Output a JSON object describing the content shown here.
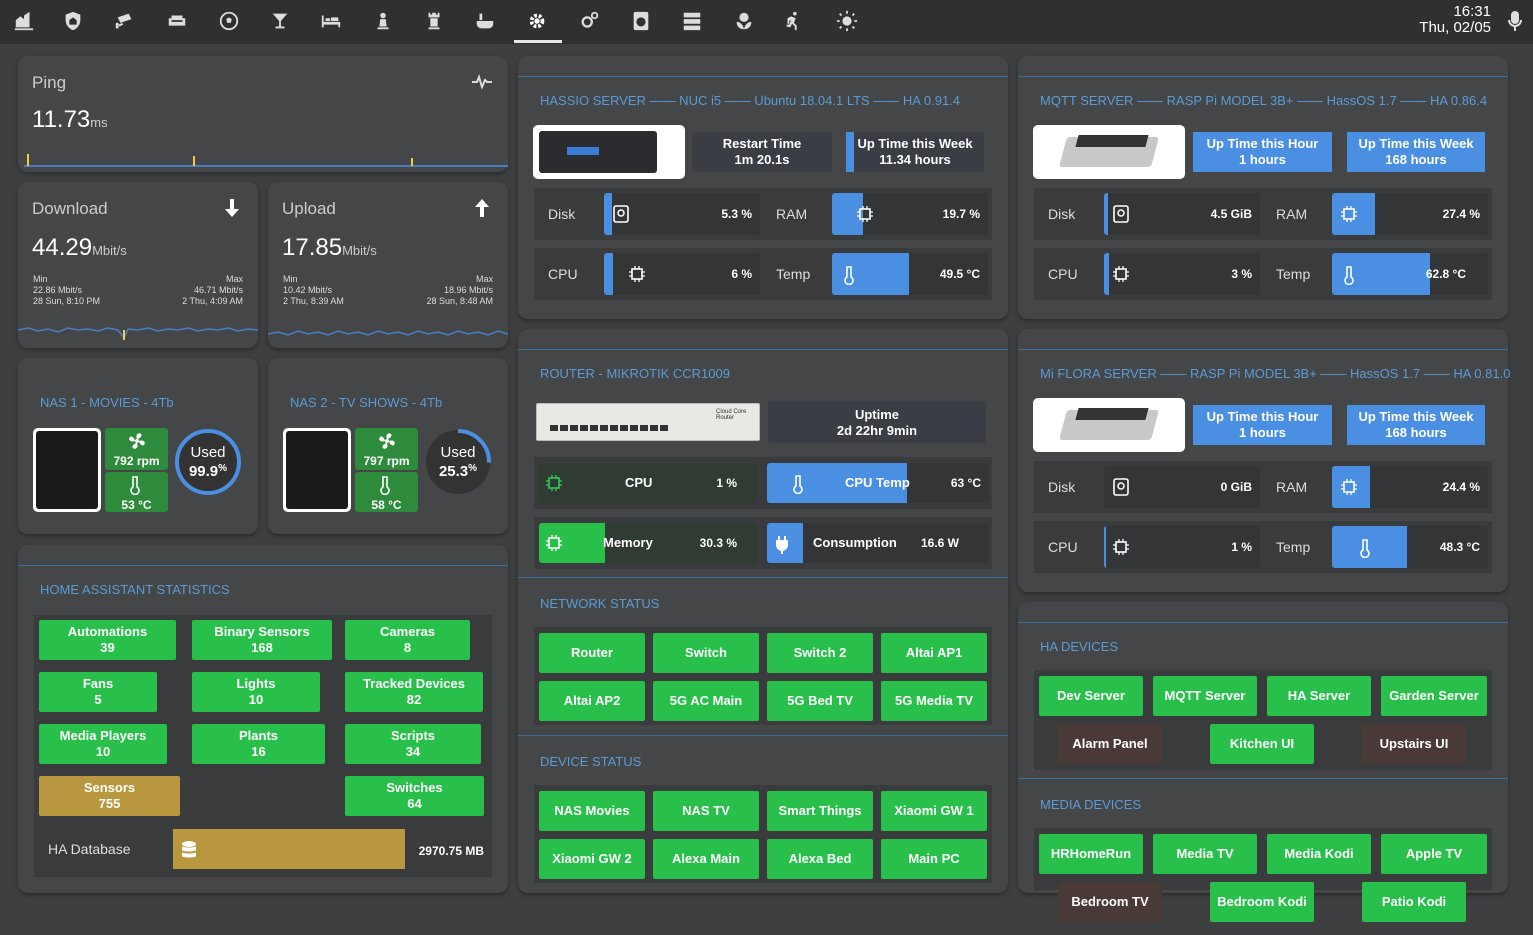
{
  "topbar": {
    "tabs": [
      "home-icon",
      "shield-icon",
      "cctv-icon",
      "sofa-icon",
      "soccer-icon",
      "cocktail-icon",
      "bed-icon",
      "chess-pawn-icon",
      "chess-rook-icon",
      "bathtub-icon",
      "cog-icon",
      "cogs-icon",
      "washing-machine-icon",
      "server-icon",
      "flower-icon",
      "run-icon",
      "sun-icon"
    ],
    "active_tab": "cog-icon",
    "time": "16:31",
    "date": "Thu, 02/05"
  },
  "ping": {
    "label": "Ping",
    "value": "11.73",
    "unit": "ms"
  },
  "download": {
    "label": "Download",
    "value": "44.29",
    "unit": "Mbit/s",
    "min_label": "Min",
    "min_value": "22.86 Mbit/s",
    "min_time": "28 Sun, 8:10 PM",
    "max_label": "Max",
    "max_value": "46.71 Mbit/s",
    "max_time": "2 Thu, 4:09 AM"
  },
  "upload": {
    "label": "Upload",
    "value": "17.85",
    "unit": "Mbit/s",
    "min_label": "Min",
    "min_value": "10.42 Mbit/s",
    "min_time": "2 Thu, 8:39 AM",
    "max_label": "Max",
    "max_value": "18.96 Mbit/s",
    "max_time": "28 Sun, 8:48 AM"
  },
  "nas1": {
    "title": "NAS 1 - MOVIES - 4Tb",
    "fan": "792 rpm",
    "temp": "53 °C",
    "used_label": "Used",
    "used_value": "99.9",
    "used_pct": 99.9
  },
  "nas2": {
    "title": "NAS 2 - TV SHOWS - 4Tb",
    "fan": "797 rpm",
    "temp": "58 °C",
    "used_label": "Used",
    "used_value": "25.3",
    "used_pct": 25.3
  },
  "ha_stats": {
    "title": "HOME ASSISTANT STATISTICS",
    "items": [
      {
        "label": "Automations",
        "value": "39"
      },
      {
        "label": "Binary Sensors",
        "value": "168"
      },
      {
        "label": "Cameras",
        "value": "8"
      },
      {
        "label": "Fans",
        "value": "5"
      },
      {
        "label": "Lights",
        "value": "10"
      },
      {
        "label": "Tracked Devices",
        "value": "82"
      },
      {
        "label": "Media Players",
        "value": "10"
      },
      {
        "label": "Plants",
        "value": "16"
      },
      {
        "label": "Scripts",
        "value": "34"
      },
      {
        "label": "Sensors",
        "value": "755"
      },
      {
        "label": "Switches",
        "value": "64"
      }
    ],
    "db_label": "HA Database",
    "db_value": "2970.75 MB"
  },
  "hassio": {
    "title": "HASSIO SERVER —— NUC i5 —— Ubuntu 18.04.1 LTS —— HA 0.91.4",
    "restart_label": "Restart Time",
    "restart_value": "1m 20.1s",
    "uptime_label": "Up Time this Week",
    "uptime_value": "11.34 hours",
    "disk_label": "Disk",
    "disk_value": "5.3 %",
    "disk_pct": 5.3,
    "ram_label": "RAM",
    "ram_value": "19.7 %",
    "ram_pct": 19.7,
    "cpu_label": "CPU",
    "cpu_value": "6 %",
    "cpu_pct": 6,
    "temp_label": "Temp",
    "temp_value": "49.5 °C",
    "temp_pct": 49.5
  },
  "router": {
    "title": "ROUTER - MIKROTIK CCR1009",
    "device_label": "Cloud Core Router",
    "uptime_label": "Uptime",
    "uptime_value": "2d 22hr 9min",
    "cpu_label": "CPU",
    "cpu_value": "1 %",
    "cputemp_label": "CPU Temp",
    "cputemp_value": "63 °C",
    "mem_label": "Memory",
    "mem_value": "30.3 %",
    "mem_pct": 30.3,
    "cons_label": "Consumption",
    "cons_value": "16.6 W"
  },
  "network": {
    "title": "NETWORK STATUS",
    "items": [
      "Router",
      "Switch",
      "Switch 2",
      "Altai AP1",
      "Altai AP2",
      "5G AC Main",
      "5G Bed TV",
      "5G Media TV"
    ]
  },
  "devstatus": {
    "title": "DEVICE STATUS",
    "items": [
      "NAS Movies",
      "NAS TV",
      "Smart Things",
      "Xiaomi GW 1",
      "Xiaomi GW 2",
      "Alexa Main",
      "Alexa Bed",
      "Main PC"
    ]
  },
  "mqtt": {
    "title": "MQTT SERVER —— RASP Pi MODEL 3B+ —— HassOS 1.7 —— HA 0.86.4",
    "hour_label": "Up Time this Hour",
    "hour_value": "1 hours",
    "week_label": "Up Time this Week",
    "week_value": "168 hours",
    "disk_label": "Disk",
    "disk_value": "4.5 GiB",
    "ram_label": "RAM",
    "ram_value": "27.4 %",
    "ram_pct": 27.4,
    "cpu_label": "CPU",
    "cpu_value": "3 %",
    "cpu_pct": 3,
    "temp_label": "Temp",
    "temp_value": "62.8 °C",
    "temp_pct": 62.8
  },
  "flora": {
    "title": "Mi FLORA SERVER —— RASP Pi MODEL 3B+ —— HassOS 1.7 —— HA 0.81.0",
    "hour_label": "Up Time this Hour",
    "hour_value": "1 hours",
    "week_label": "Up Time this Week",
    "week_value": "168 hours",
    "disk_label": "Disk",
    "disk_value": "0 GiB",
    "ram_label": "RAM",
    "ram_value": "24.4 %",
    "ram_pct": 24.4,
    "cpu_label": "CPU",
    "cpu_value": "1 %",
    "cpu_pct": 1,
    "temp_label": "Temp",
    "temp_value": "48.3 °C",
    "temp_pct": 48.3
  },
  "hadevices": {
    "title": "HA DEVICES",
    "items": [
      "Dev Server",
      "MQTT Server",
      "HA Server",
      "Garden Server",
      "Alarm Panel",
      "Kitchen UI",
      "Upstairs UI"
    ]
  },
  "media": {
    "title": "MEDIA DEVICES",
    "items": [
      "HRHomeRun",
      "Media TV",
      "Media Kodi",
      "Apple TV",
      "Bedroom TV",
      "Bedroom Kodi",
      "Patio Kodi"
    ]
  },
  "colors": {
    "accent": "#5b9bd5",
    "on": "#28c04a",
    "off": "#4a3a37",
    "bar": "#4a8fe2"
  }
}
